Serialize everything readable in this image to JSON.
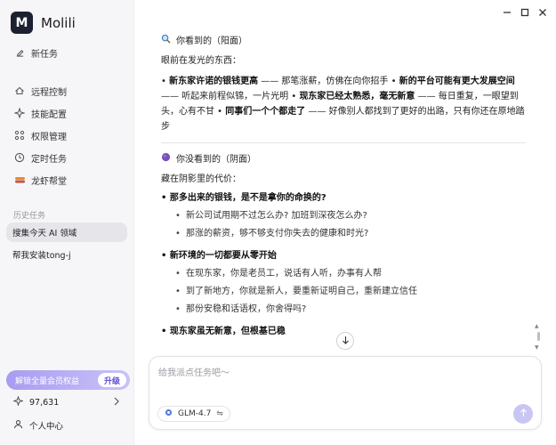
{
  "app": {
    "logo_letter": "M",
    "name": "Molili"
  },
  "sidebar": {
    "new_task": "新任务",
    "items": [
      {
        "label": "远程控制",
        "icon": "remote-icon"
      },
      {
        "label": "技能配置",
        "icon": "skill-icon"
      },
      {
        "label": "权限管理",
        "icon": "permission-icon"
      },
      {
        "label": "定时任务",
        "icon": "clock-icon"
      },
      {
        "label": "龙虾帮堂",
        "icon": "lobster-icon"
      }
    ],
    "history_label": "历史任务",
    "history": [
      {
        "label": "搜集今天 AI 领域",
        "active": true
      },
      {
        "label": "帮我安装tong-j",
        "active": false
      }
    ],
    "vip": {
      "text": "解锁全量会员权益",
      "upgrade": "升级"
    },
    "points": "97,631",
    "user_center": "个人中心"
  },
  "content": {
    "section1": {
      "title": "你看到的（阳面）",
      "intro": "眼前在发光的东西：",
      "p1_b1": "新东家许诺的银钱更高",
      "p1_t1": " —— 那笔涨薪，仿佛在向你招手 • ",
      "p1_b2": "新的平台可能有更大发展空间",
      "p1_t2": " —— 听起来前程似锦，一片光明 • ",
      "p1_b3": "现东家已经太熟悉，毫无新意",
      "p1_t3": " —— 每日重复，一眼望到头，心有不甘 • ",
      "p1_b4": "同事们一个个都走了",
      "p1_t4": " —— 好像别人都找到了更好的出路，只有你还在原地踏步"
    },
    "section2": {
      "title": "你没看到的（阴面）",
      "intro": "藏在阴影里的代价：",
      "groups": [
        {
          "heading": "那多出来的银钱，是不是拿你的命换的?",
          "items": [
            "新公司试用期不过怎么办? 加班到深夜怎么办?",
            "那涨的薪资，够不够支付你失去的健康和时光?"
          ]
        },
        {
          "heading": "新环境的一切都要从零开始",
          "items": [
            "在现东家，你是老员工，说话有人听，办事有人帮",
            "到了新地方，你就是新人，要重新证明自己，重新建立信任",
            "那份安稳和话语权，你舍得吗?"
          ]
        }
      ],
      "trailing": "现东家虽无新意，但根基已稳"
    }
  },
  "composer": {
    "placeholder": "给我派点任务吧～",
    "model": "GLM-4.7",
    "model_switch": "⇋"
  },
  "colors": {
    "accent": "#a79cf2",
    "sidebar_bg": "#f6f6f8"
  }
}
